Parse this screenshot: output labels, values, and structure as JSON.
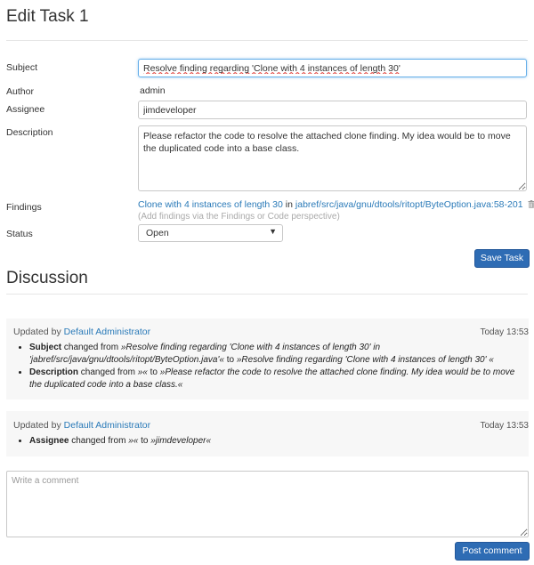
{
  "page_title": "Edit Task 1",
  "form": {
    "subject_label": "Subject",
    "subject_value": "Resolve finding regarding 'Clone with 4 instances of length 30'",
    "author_label": "Author",
    "author_value": "admin",
    "assignee_label": "Assignee",
    "assignee_value": "jimdeveloper",
    "description_label": "Description",
    "description_value": "Please refactor the code to resolve the attached clone finding. My idea would be to move the duplicated code into a base class.",
    "findings_label": "Findings",
    "finding_link": "Clone with 4 instances of length 30",
    "finding_in": "in",
    "finding_location": "jabref/src/java/gnu/dtools/ritopt/ByteOption.java:58-201",
    "findings_hint": "(Add findings via the Findings or Code perspective)",
    "status_label": "Status",
    "status_value": "Open",
    "save_label": "Save Task"
  },
  "discussion": {
    "title": "Discussion",
    "entries": [
      {
        "prefix": "Updated by",
        "user": "Default Administrator",
        "time": "Today 13:53",
        "changes": [
          {
            "field": "Subject",
            "mid": "changed from",
            "from": "»Resolve finding regarding 'Clone with 4 instances of length 30' in 'jabref/src/java/gnu/dtools/ritopt/ByteOption.java'«",
            "to_word": "to",
            "to": "»Resolve finding regarding 'Clone with 4 instances of length 30' «"
          },
          {
            "field": "Description",
            "mid": "changed from",
            "from": "»«",
            "to_word": "to",
            "to": "»Please refactor the code to resolve the attached clone finding. My idea would be to move the duplicated code into a base class.«"
          }
        ]
      },
      {
        "prefix": "Updated by",
        "user": "Default Administrator",
        "time": "Today 13:53",
        "changes": [
          {
            "field": "Assignee",
            "mid": "changed from",
            "from": "»«",
            "to_word": "to",
            "to": "»jimdeveloper«"
          }
        ]
      }
    ],
    "comment_placeholder": "Write a comment",
    "post_label": "Post comment"
  }
}
